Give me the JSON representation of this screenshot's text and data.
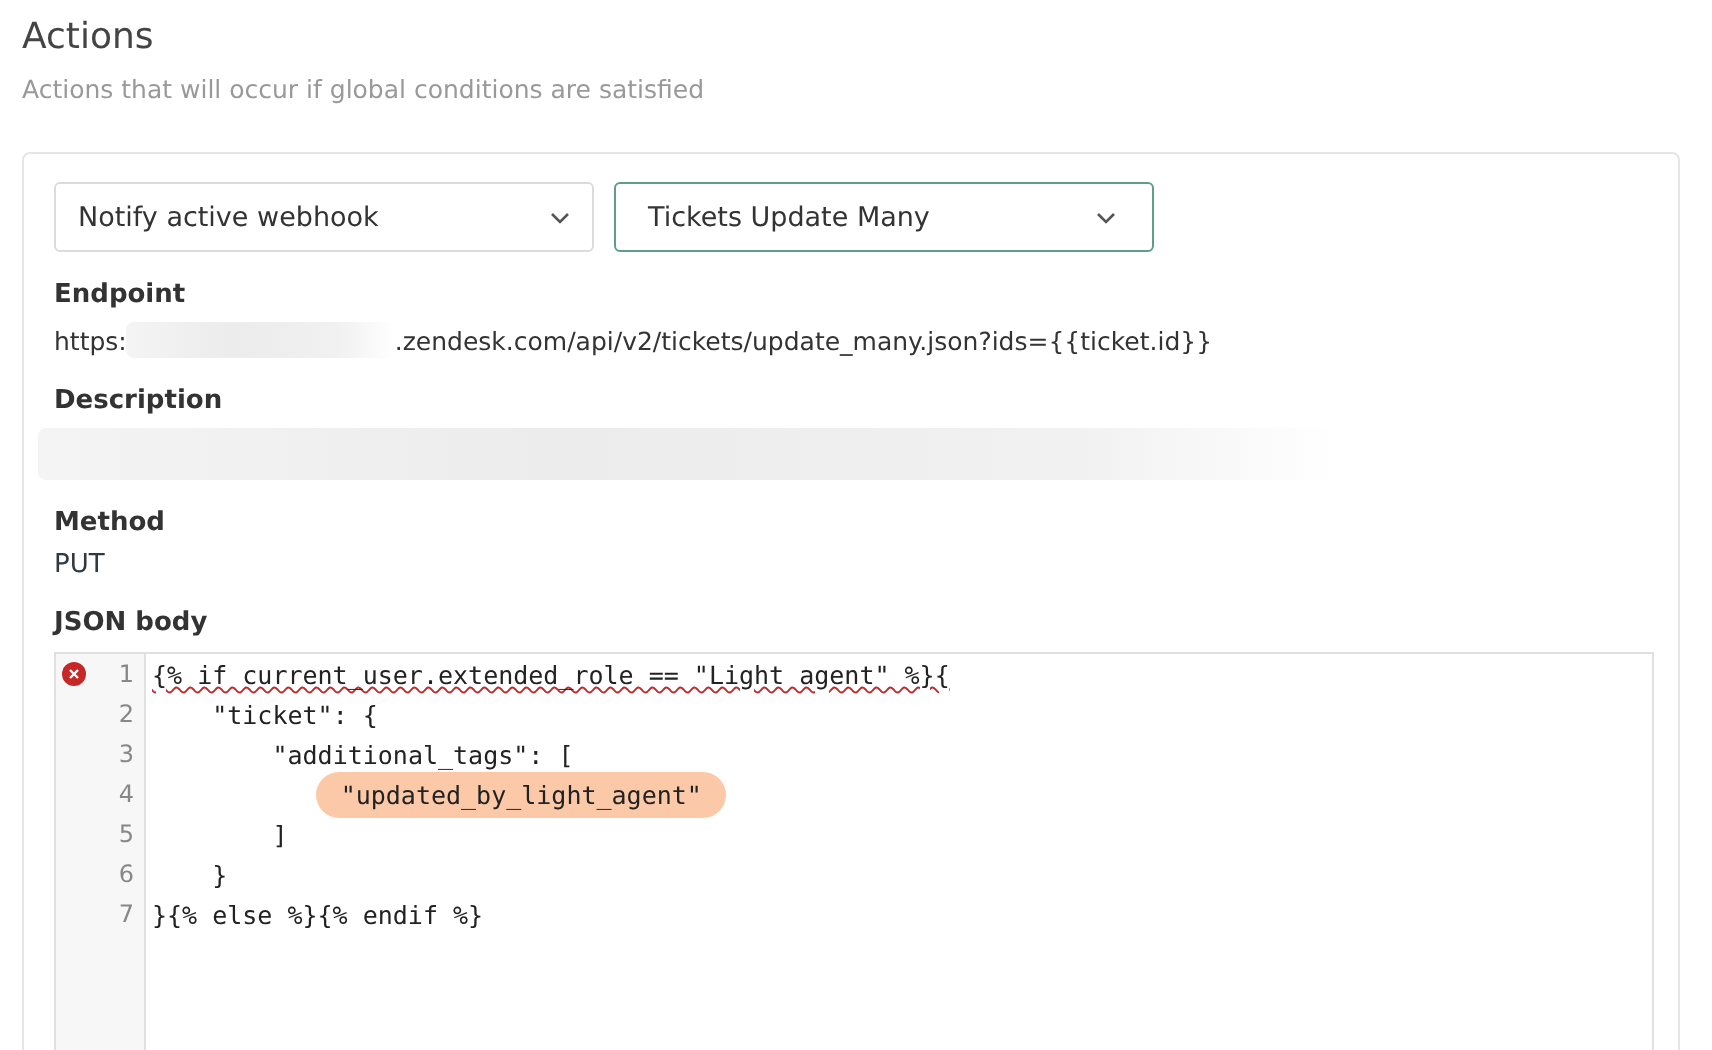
{
  "header": {
    "title": "Actions",
    "subtitle": "Actions that will occur if global conditions are satisfied"
  },
  "selects": [
    {
      "value": "Notify active webhook",
      "focused": false
    },
    {
      "value": "Tickets Update Many",
      "focused": true
    }
  ],
  "endpoint": {
    "label": "Endpoint",
    "prefix": "https:",
    "suffix": ".zendesk.com/api/v2/tickets/update_many.json?ids={{ticket.id}}"
  },
  "description": {
    "label": "Description"
  },
  "method": {
    "label": "Method",
    "value": "PUT"
  },
  "json_body": {
    "label": "JSON body",
    "lines": [
      {
        "number": "1",
        "text": "{% if current_user.extended_role == \"Light agent\" %}{",
        "error": true,
        "highlighted": false
      },
      {
        "number": "2",
        "text": "    \"ticket\": {",
        "error": false,
        "highlighted": false
      },
      {
        "number": "3",
        "text": "        \"additional_tags\": [",
        "error": false,
        "highlighted": false
      },
      {
        "number": "4",
        "text": "            \"updated_by_light_agent\"",
        "error": false,
        "highlighted": true
      },
      {
        "number": "5",
        "text": "        ]",
        "error": false,
        "highlighted": false
      },
      {
        "number": "6",
        "text": "    }",
        "error": false,
        "highlighted": false
      },
      {
        "number": "7",
        "text": "}{% else %}{% endif %}",
        "error": false,
        "highlighted": false
      }
    ]
  }
}
